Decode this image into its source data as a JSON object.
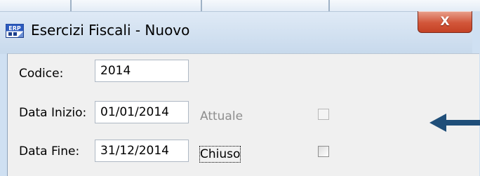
{
  "window": {
    "title": "Esercizi Fiscali - Nuovo",
    "icon": "app-erp-icon",
    "close_glyph": "X"
  },
  "form": {
    "codice": {
      "label": "Codice:",
      "value": "2014"
    },
    "data_inizio": {
      "label": "Data Inizio:",
      "value": "01/01/2014"
    },
    "data_fine": {
      "label": "Data Fine:",
      "value": "31/12/2014"
    },
    "attuale": {
      "label": "Attuale",
      "checked": false,
      "enabled": false
    },
    "chiuso": {
      "label": "Chiuso",
      "checked": false,
      "focused": true
    }
  },
  "annotation": {
    "icon": "left-arrow-icon",
    "color": "#1f4e79"
  },
  "colors": {
    "title_bar": "#c7d9ec",
    "close_button": "#d2563a",
    "form_background": "#f0f0f0"
  }
}
